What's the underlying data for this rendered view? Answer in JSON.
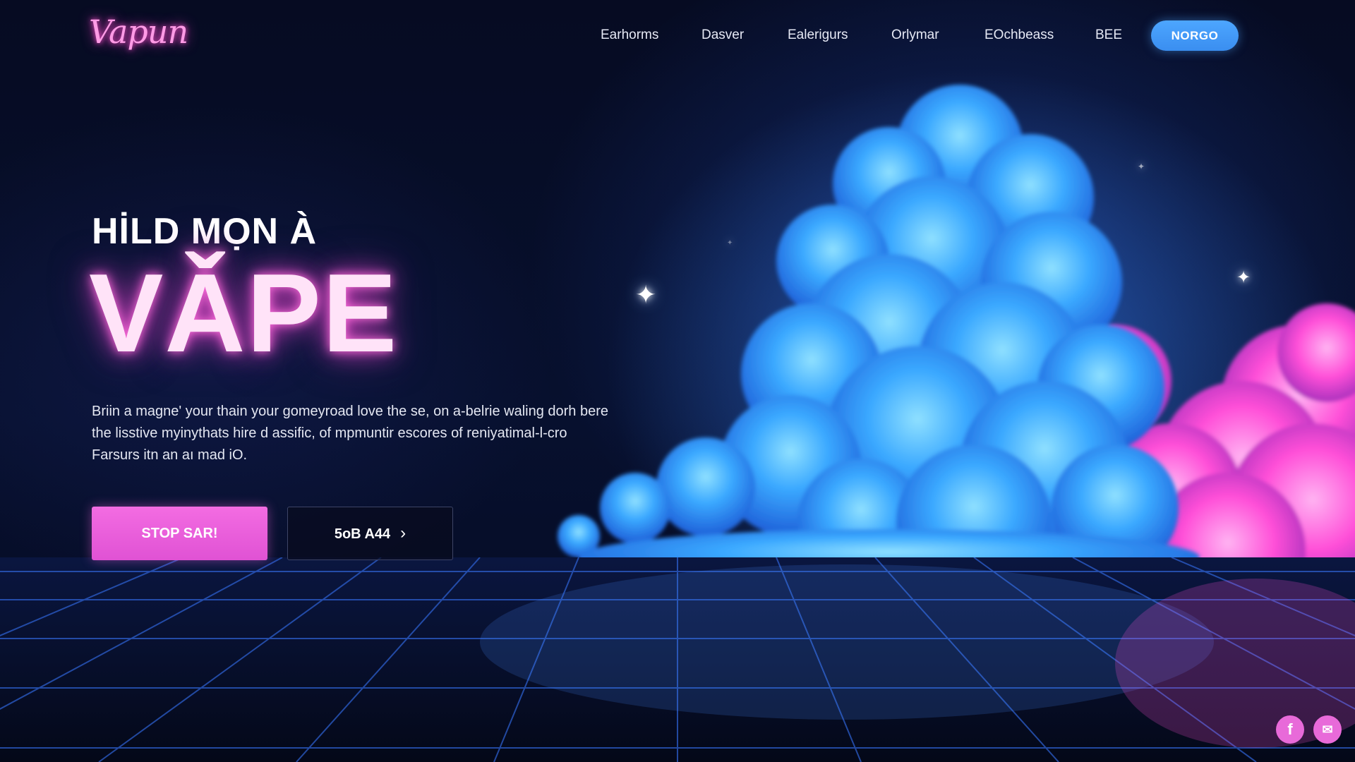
{
  "brand": {
    "logo_text": "Vapun"
  },
  "nav": {
    "items": [
      {
        "label": "Earhorms"
      },
      {
        "label": "Dasver"
      },
      {
        "label": "Ealerigurs"
      },
      {
        "label": "Orlymar"
      },
      {
        "label": "EOchbeass"
      },
      {
        "label": "BEE"
      }
    ],
    "cta_label": "NORGO"
  },
  "hero": {
    "subtitle": "HİLD MỌN À",
    "title": "VǍPE",
    "description": "Briin a magne' your thain your gomeyroad love the se, on a-belrie waling dorh bere the lisstive myinythats hire d assific, of mpmuntir escores of reniyatimal-l-cro Farsurs itn an aı mad iO.",
    "primary_button": "STOP SAR!",
    "secondary_button": "5oB A44",
    "secondary_arrow_icon": "chevron-right-icon"
  },
  "social": {
    "facebook_icon": "facebook-icon",
    "mail_icon": "mail-icon"
  },
  "colors": {
    "background": "#050a1f",
    "accent_pink": "#e052d4",
    "accent_blue": "#4da6ff",
    "cloud_blue": "#3aa8ff",
    "cloud_pink": "#ff4fd8"
  }
}
